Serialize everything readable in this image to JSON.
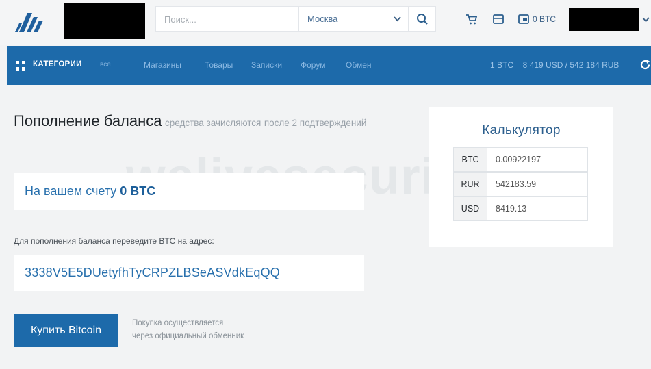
{
  "header": {
    "search": {
      "placeholder": "Поиск...",
      "value": ""
    },
    "city": {
      "selected": "Москва"
    },
    "wallet_label": "0 BTC"
  },
  "icons": {
    "logo": "brand-logo",
    "search": "search-icon",
    "city_dropdown": "chevron-down-icon",
    "cart": "cart-icon",
    "messages": "message-icon",
    "wallet": "wallet-icon",
    "user_menu": "chevron-down-icon",
    "categories": "grid-icon",
    "refresh": "refresh-icon"
  },
  "nav": {
    "categories_label": "КАТЕГОРИИ",
    "categories_all": "все",
    "links": [
      "Магазины",
      "Товары",
      "Записки",
      "Форум",
      "Обмен"
    ],
    "rate": "1 BTC = 8 419 USD / 542 184 RUB"
  },
  "main": {
    "title": "Пополнение баланса",
    "subtitle_text": "средства зачисляются",
    "subtitle_link": "после 2 подтверждений",
    "balance_prefix": "На вашем счету",
    "balance_value": "0 BTC",
    "address_label": "Для пополнения баланса переведите BTC на адрес:",
    "address": "3338V5E5DUetyfhTyCRPZLBSeASVdkEqQQ",
    "buy_button": "Купить Bitcoin",
    "buy_note_line1": "Покупка осуществляется",
    "buy_note_line2": "через официальный обменник"
  },
  "calculator": {
    "title": "Калькулятор",
    "rows": [
      {
        "code": "BTC",
        "value": "0.00922197"
      },
      {
        "code": "RUR",
        "value": "542183.59"
      },
      {
        "code": "USD",
        "value": "8419.13"
      }
    ]
  },
  "watermark": "welivesecurity",
  "colors": {
    "nav_bg": "#1d6aaa",
    "accent_text": "#2870ad",
    "page_bg": "#f2f3f4"
  }
}
